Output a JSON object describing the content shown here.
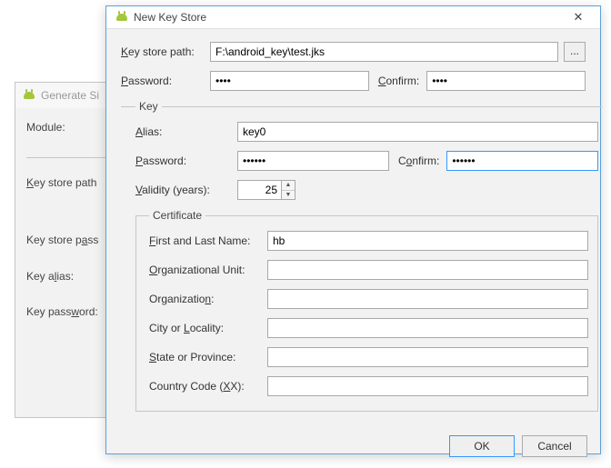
{
  "bg": {
    "title": "Generate Si",
    "module_label": "Module:",
    "ksp_label_pre": "K",
    "ksp_label_rest": "ey store path",
    "kspass_label_pre": "Key store p",
    "kspass_u": "a",
    "kspass_rest": "ss",
    "alias_pre": "Key a",
    "alias_u": "l",
    "alias_rest": "ias:",
    "kpw_pre": "Key pass",
    "kpw_u": "w",
    "kpw_rest": "ord:"
  },
  "fg": {
    "title": "New Key Store",
    "close": "✕",
    "ksp_label_pre": "K",
    "ksp_label_rest": "ey store path:",
    "ksp_value": "F:\\android_key\\test.jks",
    "browse": "...",
    "pwd_label_pre": "P",
    "pwd_label_rest": "assword:",
    "pwd_value": "••••",
    "confirm_label_pre": "C",
    "confirm_label_rest": "onfirm:",
    "confirm_value": "••••",
    "key_legend": "Key",
    "alias_label_pre": "A",
    "alias_label_rest": "lias:",
    "alias_value": "key0",
    "kpwd_label_pre": "P",
    "kpwd_label_rest": "assword:",
    "kpwd_value": "••••••",
    "kconfirm_label_pre": "C",
    "kconfirm_u": "o",
    "kconfirm_rest": "nfirm:",
    "kconfirm_value": "••••••",
    "validity_label_pre": "V",
    "validity_label_rest": "alidity (years):",
    "validity_value": "25",
    "cert_legend": "Certificate",
    "fln_pre": "F",
    "fln_rest": "irst and Last Name:",
    "fln_value": "hb",
    "ou_pre": "O",
    "ou_rest": "rganizational Unit:",
    "org_pre": "Organizatio",
    "org_u": "n",
    "org_rest": ":",
    "city_pre": "City or ",
    "city_u": "L",
    "city_rest": "ocality:",
    "state_pre": "S",
    "state_rest": "tate or Province:",
    "cc_pre": "Country Code (",
    "cc_u": "X",
    "cc_rest": "X):",
    "ok": "OK",
    "cancel": "Cancel"
  }
}
